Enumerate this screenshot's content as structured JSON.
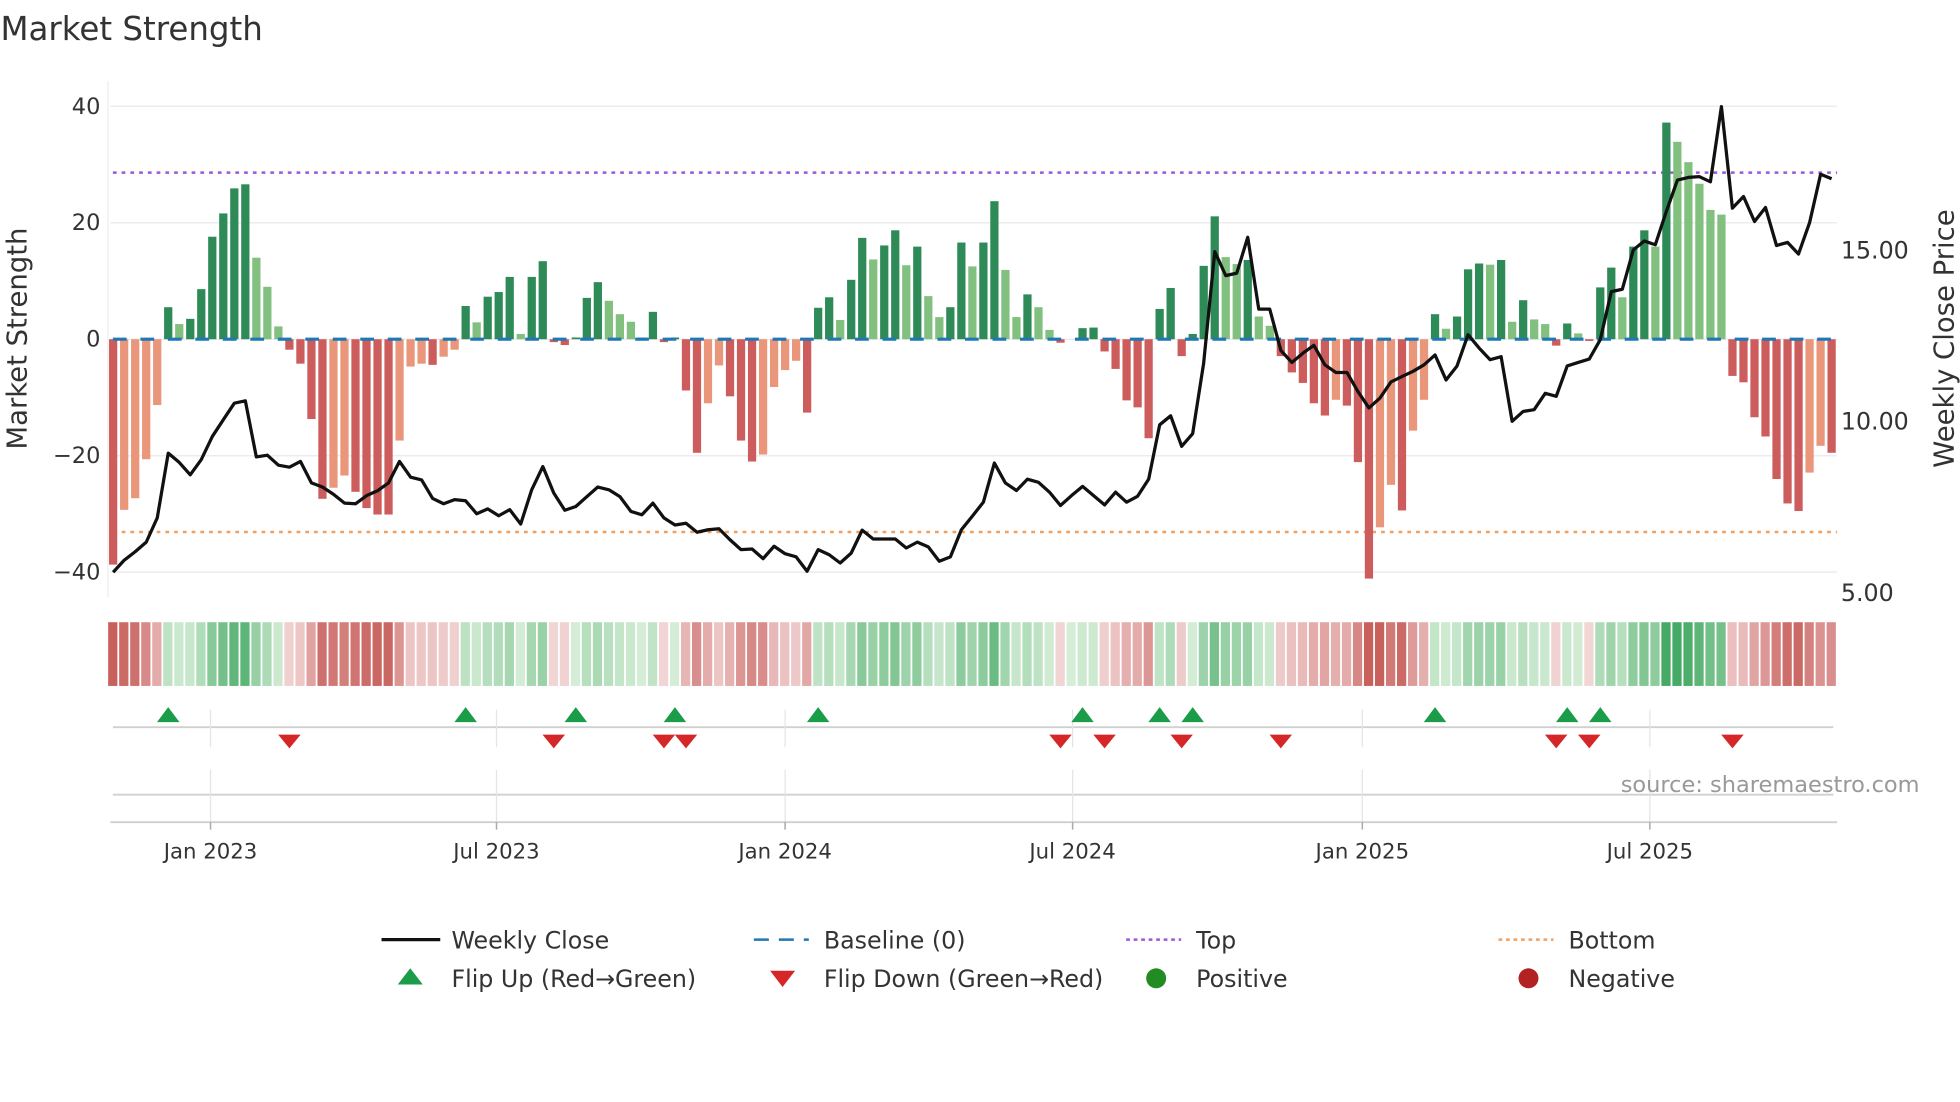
{
  "title": "Market Strength",
  "source": "source: sharemaestro.com",
  "colors": {
    "up_dark": "#2e8b57",
    "up_light": "#82c07f",
    "down_dark": "#cd5c5c",
    "down_light": "#e9967a",
    "baseline": "#1f77b4",
    "top": "#9b59d6",
    "bottom": "#f0a060",
    "flip_up": "#1a9c48",
    "flip_down": "#d62728",
    "positive": "#228b22",
    "negative": "#b22222",
    "close": "#111111"
  },
  "chart_data": {
    "type": "bar",
    "title": "Market Strength",
    "ylabel": "Market Strength",
    "y2label": "Weekly Close Price",
    "ylim": [
      -44.3,
      44.3
    ],
    "y2lim": [
      4.85,
      19.93
    ],
    "xlim_weeks": [
      -0.25,
      156.5
    ],
    "yticks": [
      {
        "v": 40,
        "label": "40"
      },
      {
        "v": 20,
        "label": "20"
      },
      {
        "v": 0,
        "label": "0"
      },
      {
        "v": -20,
        "label": "−20"
      },
      {
        "v": -40,
        "label": "−40"
      }
    ],
    "y2ticks": [
      {
        "v": 15,
        "label": "15.00"
      },
      {
        "v": 10,
        "label": "10.00"
      },
      {
        "v": 5,
        "label": "5.00"
      }
    ],
    "xticks": [
      {
        "week": 8.84,
        "label": "Jan 2023"
      },
      {
        "week": 34.8,
        "label": "Jul 2023"
      },
      {
        "week": 61.0,
        "label": "Jan 2024"
      },
      {
        "week": 87.1,
        "label": "Jul 2024"
      },
      {
        "week": 113.4,
        "label": "Jan 2025"
      },
      {
        "week": 139.5,
        "label": "Jul 2025"
      }
    ],
    "top": 28.6,
    "bottom": -33.1,
    "baseline": 0,
    "strength": [
      -38.7,
      -29.3,
      -27.3,
      -20.6,
      -11.3,
      5.5,
      2.6,
      3.5,
      8.6,
      17.6,
      21.6,
      25.9,
      26.6,
      14,
      9,
      2.2,
      -1.8,
      -4.2,
      -13.7,
      -27.4,
      -25.5,
      -23.4,
      -26.2,
      -29,
      -30.1,
      -30.1,
      -17.4,
      -4.7,
      -4.2,
      -4.4,
      -3,
      -1.8,
      5.7,
      2.9,
      7.3,
      8.1,
      10.7,
      0.9,
      10.7,
      13.4,
      -0.5,
      -1.0,
      0.3,
      7.1,
      9.8,
      6.6,
      4.3,
      3,
      0.3,
      4.7,
      -0.5,
      0.3,
      -8.8,
      -19.5,
      -11,
      -4.5,
      -9.8,
      -17.4,
      -21,
      -19.8,
      -8.2,
      -5.3,
      -3.7,
      -12.6,
      5.4,
      7.2,
      3.3,
      10.2,
      17.4,
      13.7,
      16.1,
      18.7,
      12.7,
      15.9,
      7.4,
      3.8,
      5.5,
      16.6,
      12.5,
      16.6,
      23.7,
      11.9,
      3.8,
      7.7,
      5.5,
      1.6,
      -0.6,
      0,
      1.9,
      2,
      -2.1,
      -5.1,
      -10.5,
      -11.7,
      -17,
      5.2,
      8.8,
      -2.9,
      0.9,
      12.6,
      21.1,
      14.1,
      12.9,
      13.6,
      3.9,
      2.3,
      -2.9,
      -5.7,
      -7.5,
      -11,
      -13.1,
      -10.4,
      -11.4,
      -21.1,
      -41.1,
      -32.3,
      -25,
      -29.4,
      -15.7,
      -10.4,
      4.3,
      1.8,
      3.9,
      12,
      13,
      12.8,
      13.6,
      3,
      6.7,
      3.4,
      2.6,
      -1.1,
      2.7,
      1,
      -0.3,
      8.9,
      12.3,
      7.2,
      15.9,
      18.7,
      15.9,
      37.2,
      33.9,
      30.4,
      26.7,
      22.2,
      21.4,
      -6.3,
      -7.4,
      -13.4,
      -16.7,
      -24,
      -28.2,
      -29.5,
      -22.9,
      -18.3,
      -19.5
    ],
    "weekly_close": [
      5.58,
      5.93,
      6.18,
      6.46,
      7.17,
      9.06,
      8.79,
      8.43,
      8.87,
      9.55,
      10.04,
      10.52,
      10.59,
      8.95,
      9.0,
      8.71,
      8.65,
      8.82,
      8.19,
      8.07,
      7.86,
      7.6,
      7.58,
      7.82,
      7.96,
      8.19,
      8.82,
      8.36,
      8.28,
      7.74,
      7.58,
      7.7,
      7.67,
      7.29,
      7.43,
      7.23,
      7.41,
      6.99,
      7.99,
      8.67,
      7.89,
      7.39,
      7.5,
      7.79,
      8.07,
      7.99,
      7.79,
      7.36,
      7.26,
      7.6,
      7.17,
      6.96,
      7.01,
      6.75,
      6.82,
      6.85,
      6.53,
      6.24,
      6.26,
      5.98,
      6.34,
      6.12,
      6.03,
      5.61,
      6.24,
      6.09,
      5.85,
      6.14,
      6.81,
      6.55,
      6.55,
      6.55,
      6.29,
      6.46,
      6.32,
      5.9,
      6.03,
      6.82,
      7.22,
      7.63,
      8.77,
      8.19,
      7.97,
      8.3,
      8.21,
      7.92,
      7.53,
      7.82,
      8.09,
      7.82,
      7.55,
      7.92,
      7.63,
      7.8,
      8.3,
      9.89,
      10.15,
      9.26,
      9.63,
      11.69,
      14.95,
      14.25,
      14.32,
      15.37,
      13.27,
      13.27,
      12.06,
      11.71,
      11.98,
      12.21,
      11.64,
      11.42,
      11.42,
      10.86,
      10.38,
      10.67,
      11.14,
      11.3,
      11.45,
      11.64,
      11.93,
      11.2,
      11.61,
      12.52,
      12.13,
      11.79,
      11.88,
      9.99,
      10.28,
      10.33,
      10.81,
      10.72,
      11.61,
      11.71,
      11.81,
      12.37,
      13.78,
      13.85,
      15.0,
      15.26,
      15.15,
      16.12,
      17.04,
      17.12,
      17.14,
      16.99,
      19.19,
      16.22,
      16.56,
      15.83,
      16.24,
      15.13,
      15.22,
      14.88,
      15.8,
      17.21,
      17.08
    ],
    "flip_up_weeks": [
      5,
      32,
      42,
      51,
      64,
      88,
      95,
      98,
      120,
      132,
      135
    ],
    "flip_down_weeks": [
      16,
      40,
      50,
      52,
      86,
      90,
      97,
      106,
      131,
      134,
      147
    ],
    "legend": {
      "placement": "bottom",
      "items": [
        {
          "key": "close",
          "label": "Weekly Close"
        },
        {
          "key": "baseline",
          "label": "Baseline (0)"
        },
        {
          "key": "top",
          "label": "Top"
        },
        {
          "key": "bottom",
          "label": "Bottom"
        },
        {
          "key": "flip_up",
          "label": "Flip Up (Red→Green)"
        },
        {
          "key": "flip_down",
          "label": "Flip Down (Green→Red)"
        },
        {
          "key": "positive",
          "label": "Positive"
        },
        {
          "key": "negative",
          "label": "Negative"
        }
      ]
    }
  }
}
